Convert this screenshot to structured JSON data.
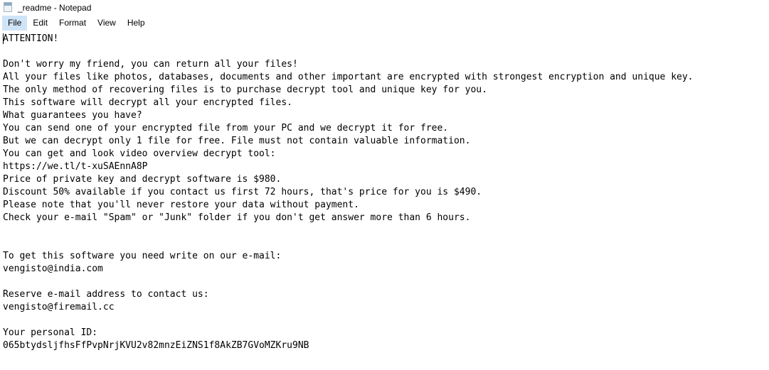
{
  "window": {
    "title": "_readme - Notepad",
    "icon": "notepad-icon"
  },
  "menu": {
    "items": [
      {
        "label": "File",
        "active": true
      },
      {
        "label": "Edit",
        "active": false
      },
      {
        "label": "Format",
        "active": false
      },
      {
        "label": "View",
        "active": false
      },
      {
        "label": "Help",
        "active": false
      }
    ]
  },
  "document": {
    "filename": "_readme",
    "content": "ATTENTION!\n\nDon't worry my friend, you can return all your files!\nAll your files like photos, databases, documents and other important are encrypted with strongest encryption and unique key.\nThe only method of recovering files is to purchase decrypt tool and unique key for you.\nThis software will decrypt all your encrypted files.\nWhat guarantees you have?\nYou can send one of your encrypted file from your PC and we decrypt it for free.\nBut we can decrypt only 1 file for free. File must not contain valuable information.\nYou can get and look video overview decrypt tool:\nhttps://we.tl/t-xuSAEnnA8P\nPrice of private key and decrypt software is $980.\nDiscount 50% available if you contact us first 72 hours, that's price for you is $490.\nPlease note that you'll never restore your data without payment.\nCheck your e-mail \"Spam\" or \"Junk\" folder if you don't get answer more than 6 hours.\n\n\nTo get this software you need write on our e-mail:\nvengisto@india.com\n\nReserve e-mail address to contact us:\nvengisto@firemail.cc\n\nYour personal ID:\n065btydsljfhsFfPvpNrjKVU2v82mnzEiZNS1f8AkZB7GVoMZKru9NB",
    "details": {
      "heading": "ATTENTION!",
      "video_url": "https://we.tl/t-xuSAEnnA8P",
      "price": "$980",
      "discount_price": "$490",
      "discount_percent": "50%",
      "discount_window_hours": "72 hours",
      "response_time": "6 hours",
      "primary_email": "vengisto@india.com",
      "reserve_email": "vengisto@firemail.cc",
      "personal_id": "065btydsljfhsFfPvpNrjKVU2v82mnzEiZNS1f8AkZB7GVoMZKru9NB"
    }
  },
  "colors": {
    "background": "#ffffff",
    "text": "#000000",
    "menu_highlight": "#cfe4f7"
  }
}
